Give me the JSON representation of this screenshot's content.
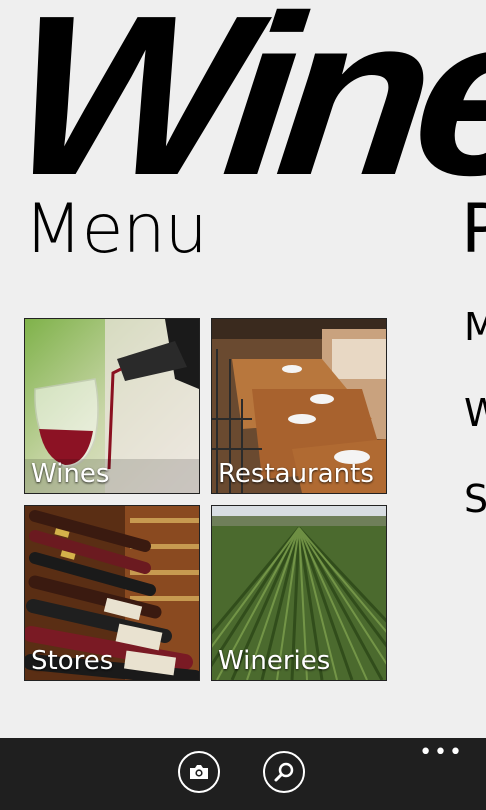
{
  "header": {
    "app_title": "Wine"
  },
  "menu": {
    "title": "Menu",
    "tiles": [
      {
        "label": "Wines"
      },
      {
        "label": "Restaurants"
      },
      {
        "label": "Stores"
      },
      {
        "label": "Wineries"
      }
    ]
  },
  "next_panel": {
    "title": "P",
    "items": [
      {
        "label": "M"
      },
      {
        "label": "W"
      },
      {
        "label": "S"
      }
    ]
  },
  "app_bar": {
    "buttons": [
      {
        "icon": "camera-icon"
      },
      {
        "icon": "search-icon"
      }
    ],
    "more_label": "•••"
  },
  "colors": {
    "background": "#efefef",
    "app_bar": "#1f1f1f",
    "text": "#000000",
    "tile_text": "#ffffff"
  }
}
